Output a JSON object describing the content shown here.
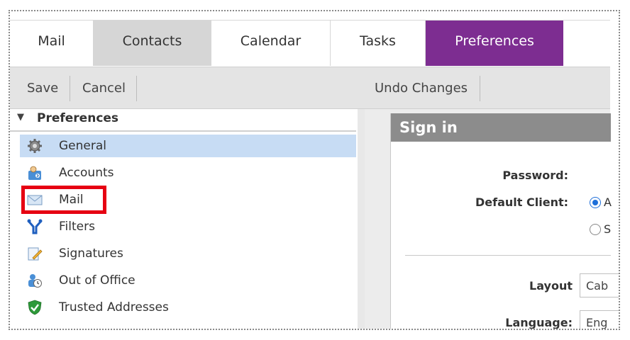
{
  "tabs": [
    {
      "label": "Mail"
    },
    {
      "label": "Contacts"
    },
    {
      "label": "Calendar"
    },
    {
      "label": "Tasks"
    },
    {
      "label": "Preferences"
    }
  ],
  "toolbar": {
    "save_label": "Save",
    "cancel_label": "Cancel",
    "undo_label": "Undo Changes"
  },
  "tree": {
    "header": "Preferences",
    "items": [
      {
        "label": "General",
        "icon": "gear-icon"
      },
      {
        "label": "Accounts",
        "icon": "accounts-icon"
      },
      {
        "label": "Mail",
        "icon": "envelope-icon"
      },
      {
        "label": "Filters",
        "icon": "filter-icon"
      },
      {
        "label": "Signatures",
        "icon": "signature-icon"
      },
      {
        "label": "Out of Office",
        "icon": "out-of-office-icon"
      },
      {
        "label": "Trusted Addresses",
        "icon": "shield-check-icon"
      }
    ]
  },
  "panel": {
    "title": "Sign in",
    "password_label": "Password:",
    "default_client_label": "Default Client:",
    "client_option_1": "A",
    "client_option_2": "S",
    "layout_label": "Layout",
    "layout_value": "Cab",
    "language_label": "Language:",
    "language_value": "Eng"
  },
  "colors": {
    "active_tab": "#7d2d91",
    "contacts_tab": "#d6d6d6",
    "selected_item": "#c7dcf4",
    "highlight_box": "#e60012",
    "panel_header": "#8c8c8c"
  }
}
